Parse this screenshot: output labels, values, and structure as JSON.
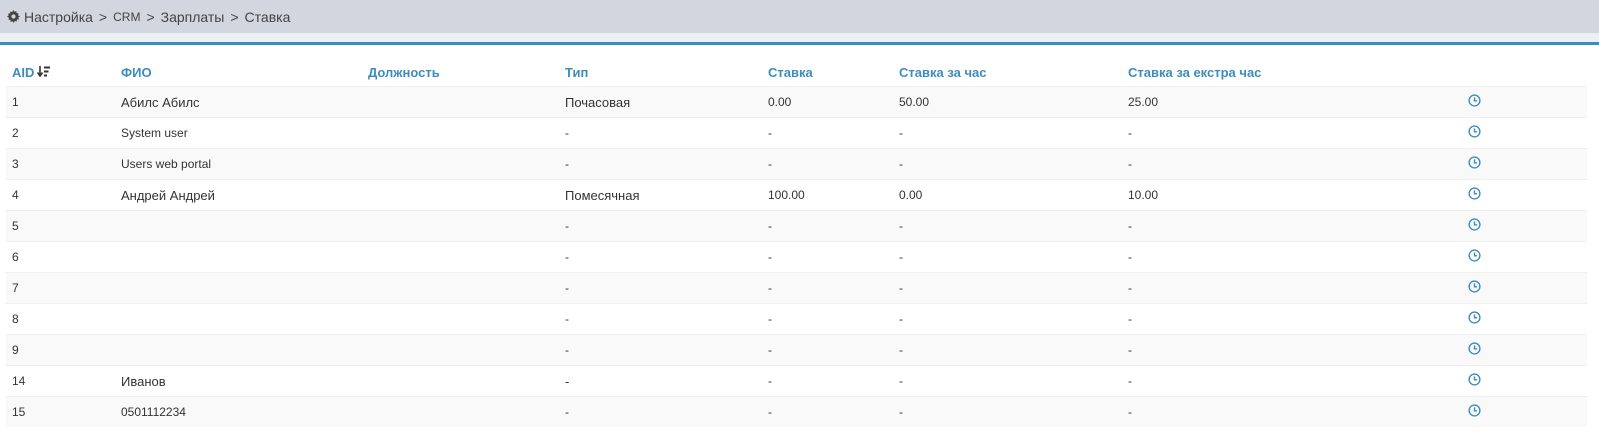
{
  "breadcrumb": {
    "icon": "gear-icon",
    "items": [
      "Настройка",
      "CRM",
      "Зарплаты",
      "Ставка"
    ],
    "separator": ">"
  },
  "table": {
    "columns": [
      "AID",
      "ФИО",
      "Должность",
      "Тип",
      "Ставка",
      "Ставка за час",
      "Ставка за екстра час"
    ],
    "sort_icon": "sort-numeric-desc-icon",
    "action_icon": "clock-icon",
    "rows": [
      {
        "aid": "1",
        "fio": "Абилс Абилс",
        "position": "",
        "type": "Почасовая",
        "rate": "0.00",
        "hour": "50.00",
        "extra": "25.00"
      },
      {
        "aid": "2",
        "fio": "System user",
        "position": "",
        "type": "-",
        "rate": "-",
        "hour": "-",
        "extra": "-"
      },
      {
        "aid": "3",
        "fio": "Users web portal",
        "position": "",
        "type": "-",
        "rate": "-",
        "hour": "-",
        "extra": "-"
      },
      {
        "aid": "4",
        "fio": "Андрей Андрей",
        "position": "",
        "type": "Помесячная",
        "rate": "100.00",
        "hour": "0.00",
        "extra": "10.00"
      },
      {
        "aid": "5",
        "fio": "",
        "position": "",
        "type": "-",
        "rate": "-",
        "hour": "-",
        "extra": "-"
      },
      {
        "aid": "6",
        "fio": "",
        "position": "",
        "type": "-",
        "rate": "-",
        "hour": "-",
        "extra": "-"
      },
      {
        "aid": "7",
        "fio": "",
        "position": "",
        "type": "-",
        "rate": "-",
        "hour": "-",
        "extra": "-"
      },
      {
        "aid": "8",
        "fio": "",
        "position": "",
        "type": "-",
        "rate": "-",
        "hour": "-",
        "extra": "-"
      },
      {
        "aid": "9",
        "fio": "",
        "position": "",
        "type": "-",
        "rate": "-",
        "hour": "-",
        "extra": "-"
      },
      {
        "aid": "14",
        "fio": "Иванов",
        "position": "",
        "type": "-",
        "rate": "-",
        "hour": "-",
        "extra": "-"
      },
      {
        "aid": "15",
        "fio": "0501112234",
        "position": "",
        "type": "-",
        "rate": "-",
        "hour": "-",
        "extra": "-"
      }
    ]
  },
  "colors": {
    "accent": "#3c8dbc",
    "topbar": "#d2d6de",
    "row_alt": "#f9f9f9"
  }
}
